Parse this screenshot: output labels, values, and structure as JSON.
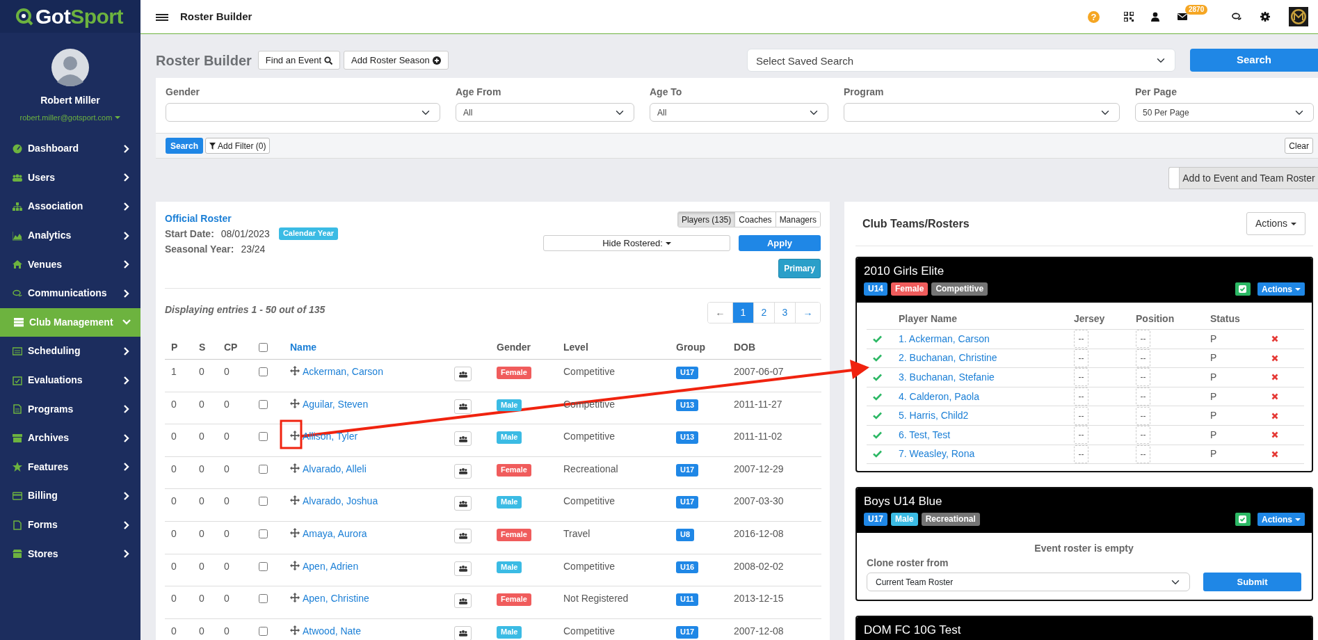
{
  "sidebar": {
    "logo": {
      "first": "Got",
      "second": "Sport"
    },
    "user": {
      "name": "Robert Miller",
      "email": "robert.miller@gotsport.com"
    },
    "items": [
      {
        "label": "Dashboard",
        "selected": false
      },
      {
        "label": "Users",
        "selected": false
      },
      {
        "label": "Association",
        "selected": false
      },
      {
        "label": "Analytics",
        "selected": false
      },
      {
        "label": "Venues",
        "selected": false
      },
      {
        "label": "Communications",
        "selected": false
      },
      {
        "label": "Club Management",
        "selected": true
      },
      {
        "label": "Scheduling",
        "selected": false
      },
      {
        "label": "Evaluations",
        "selected": false
      },
      {
        "label": "Programs",
        "selected": false
      },
      {
        "label": "Archives",
        "selected": false
      },
      {
        "label": "Features",
        "selected": false
      },
      {
        "label": "Billing",
        "selected": false
      },
      {
        "label": "Forms",
        "selected": false
      },
      {
        "label": "Stores",
        "selected": false
      }
    ]
  },
  "header": {
    "title": "Roster Builder",
    "help": "?",
    "mail_count": "2870"
  },
  "toolbar": {
    "title": "Roster Builder",
    "buttons": [
      "Find an Event",
      "Add Roster Season"
    ],
    "saved_search": "Select Saved Search",
    "search": "Search"
  },
  "filters": [
    {
      "label": "Gender"
    },
    {
      "label": "Age From",
      "value": "All"
    },
    {
      "label": "Age To",
      "value": "All"
    },
    {
      "label": "Program"
    },
    {
      "label": "Per Page",
      "value": "50 Per Page"
    }
  ],
  "filter_bar": {
    "search": "Search",
    "add_filter": "Add Filter (0)",
    "clear": "Clear"
  },
  "add_to_event": "Add to Event and Team Roster",
  "roster": {
    "title": "Official Roster",
    "start_date_label": "Start Date:",
    "start_date": "08/01/2023",
    "calendar_tag": "Calendar Year",
    "season_label": "Seasonal Year:",
    "season": "23/24",
    "tabs": [
      {
        "label": "Players (135)",
        "selected": true
      },
      {
        "label": "Coaches",
        "selected": false
      },
      {
        "label": "Managers",
        "selected": false
      }
    ],
    "hide_rostered": "Hide Rostered:",
    "apply": "Apply",
    "primary": "Primary",
    "summary": "Displaying entries 1 - 50 out of 135",
    "pages": [
      {
        "label": "←",
        "selected": false
      },
      {
        "label": "1",
        "selected": true
      },
      {
        "label": "2",
        "selected": false
      },
      {
        "label": "3",
        "selected": false
      },
      {
        "label": "→",
        "selected": false
      }
    ],
    "columns": [
      "P",
      "S",
      "CP",
      "Name",
      "Gender",
      "Level",
      "Group",
      "DOB"
    ],
    "all_checked": false,
    "rows": [
      {
        "p": "1",
        "s": "0",
        "cp": "0",
        "checked": false,
        "name": "Ackerman, Carson",
        "gender": {
          "label": "Female",
          "color": "#f05c5c"
        },
        "level": "Competitive",
        "group": "U17",
        "dob": "2007-06-07"
      },
      {
        "p": "0",
        "s": "0",
        "cp": "0",
        "checked": false,
        "name": "Aguilar, Steven",
        "gender": {
          "label": "Male",
          "color": "#3bbbe4"
        },
        "level": "Competitive",
        "group": "U13",
        "dob": "2011-11-27"
      },
      {
        "p": "0",
        "s": "0",
        "cp": "0",
        "checked": false,
        "name": "Allison, Tyler",
        "gender": {
          "label": "Male",
          "color": "#3bbbe4"
        },
        "level": "Competitive",
        "group": "U13",
        "dob": "2011-11-02"
      },
      {
        "p": "0",
        "s": "0",
        "cp": "0",
        "checked": false,
        "name": "Alvarado, Alleli",
        "gender": {
          "label": "Female",
          "color": "#f05c5c"
        },
        "level": "Recreational",
        "group": "U17",
        "dob": "2007-12-29"
      },
      {
        "p": "0",
        "s": "0",
        "cp": "0",
        "checked": false,
        "name": "Alvarado, Joshua",
        "gender": {
          "label": "Male",
          "color": "#3bbbe4"
        },
        "level": "Competitive",
        "group": "U17",
        "dob": "2007-03-30"
      },
      {
        "p": "0",
        "s": "0",
        "cp": "0",
        "checked": false,
        "name": "Amaya, Aurora",
        "gender": {
          "label": "Female",
          "color": "#f05c5c"
        },
        "level": "Travel",
        "group": "U8",
        "dob": "2016-12-08"
      },
      {
        "p": "0",
        "s": "0",
        "cp": "0",
        "checked": false,
        "name": "Apen, Adrien",
        "gender": {
          "label": "Male",
          "color": "#3bbbe4"
        },
        "level": "Competitive",
        "group": "U16",
        "dob": "2008-02-02"
      },
      {
        "p": "0",
        "s": "0",
        "cp": "0",
        "checked": false,
        "name": "Apen, Christine",
        "gender": {
          "label": "Female",
          "color": "#f05c5c"
        },
        "level": "Not Registered",
        "group": "U11",
        "dob": "2013-12-15"
      },
      {
        "p": "0",
        "s": "0",
        "cp": "0",
        "checked": false,
        "name": "Atwood, Nate",
        "gender": {
          "label": "Male",
          "color": "#3bbbe4"
        },
        "level": "Competitive",
        "group": "U17",
        "dob": "2007-12-08"
      }
    ]
  },
  "club_teams": {
    "title": "Club Teams/Rosters",
    "actions": "Actions",
    "teams": [
      {
        "kind": "roster",
        "name": "2010 Girls Elite",
        "actions": "Actions",
        "tags": [
          {
            "label": "U14",
            "color": "#1f87e6"
          },
          {
            "label": "Female",
            "color": "#f05c5c"
          },
          {
            "label": "Competitive",
            "color": "#757575"
          }
        ],
        "columns": [
          "Player Name",
          "Jersey",
          "Position",
          "Status"
        ],
        "players": [
          {
            "name": "1. Ackerman, Carson",
            "jersey": "--",
            "position": "--",
            "status": "P"
          },
          {
            "name": "2. Buchanan, Christine",
            "jersey": "--",
            "position": "--",
            "status": "P"
          },
          {
            "name": "3. Buchanan, Stefanie",
            "jersey": "--",
            "position": "--",
            "status": "P"
          },
          {
            "name": "4. Calderon, Paola",
            "jersey": "--",
            "position": "--",
            "status": "P"
          },
          {
            "name": "5. Harris, Child2",
            "jersey": "--",
            "position": "--",
            "status": "P"
          },
          {
            "name": "6. Test, Test",
            "jersey": "--",
            "position": "--",
            "status": "P"
          },
          {
            "name": "7. Weasley, Rona",
            "jersey": "--",
            "position": "--",
            "status": "P"
          }
        ]
      },
      {
        "kind": "empty",
        "name": "Boys U14 Blue",
        "actions": "Actions",
        "tags": [
          {
            "label": "U17",
            "color": "#1f87e6"
          },
          {
            "label": "Male",
            "color": "#3bbbe4"
          },
          {
            "label": "Recreational",
            "color": "#757575"
          }
        ],
        "empty_text": "Event roster is empty",
        "clone_label": "Clone roster from",
        "clone_value": "Current Team Roster",
        "submit": "Submit"
      },
      {
        "kind": "collapsed",
        "name": "DOM FC 10G Test"
      }
    ]
  }
}
